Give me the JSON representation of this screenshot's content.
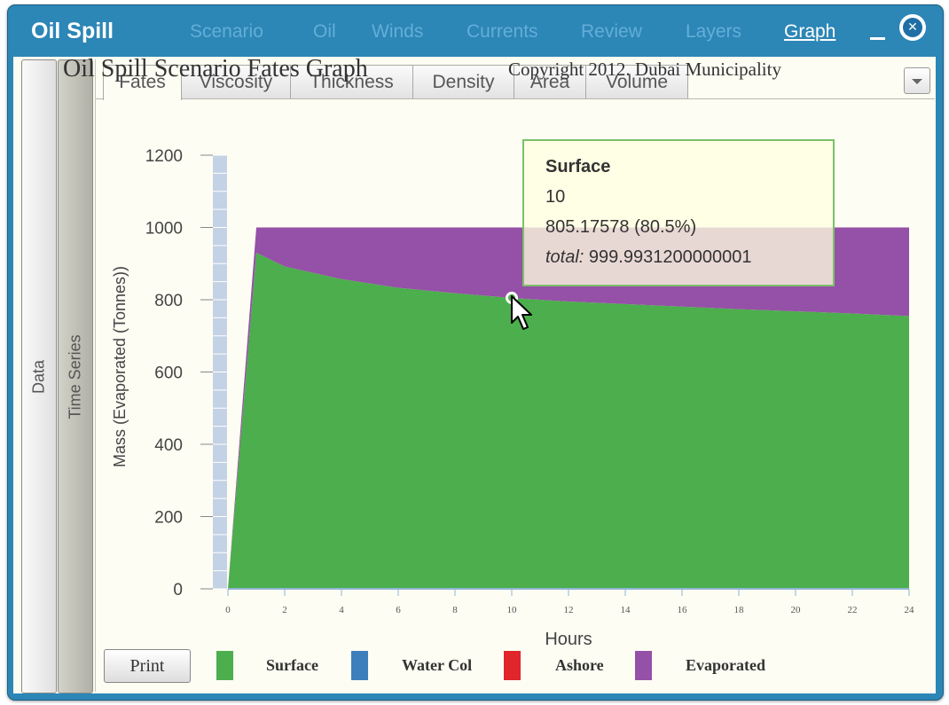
{
  "window": {
    "title": "Oil Spill",
    "menu": [
      {
        "label": "Scenario",
        "active": false
      },
      {
        "label": "Oil",
        "active": false
      },
      {
        "label": "Winds",
        "active": false
      },
      {
        "label": "Currents",
        "active": false
      },
      {
        "label": "Review",
        "active": false
      },
      {
        "label": "Layers",
        "active": false
      },
      {
        "label": "Graph",
        "active": true
      }
    ],
    "minimize_icon": "minimize-icon",
    "close_icon": "close-icon"
  },
  "side_tabs": [
    {
      "label": "Data",
      "selected": false
    },
    {
      "label": "Time Series",
      "selected": true
    }
  ],
  "tabs": [
    {
      "label": "Fates",
      "selected": true
    },
    {
      "label": "Viscosity",
      "selected": false
    },
    {
      "label": "Thickness",
      "selected": false
    },
    {
      "label": "Density",
      "selected": false
    },
    {
      "label": "Area",
      "selected": false
    },
    {
      "label": "Volume",
      "selected": false
    }
  ],
  "tooltip": {
    "series": "Surface",
    "x": "10",
    "value": "805.17578 (80.5%)",
    "total_label": "total:",
    "total_value": " 999.9931200000001"
  },
  "print_label": "Print",
  "chart_data": {
    "type": "area",
    "stacked": true,
    "title": "Oil Spill Scenario Fates Graph",
    "subtitle": "Copyright 2012. Dubai Municipality",
    "xlabel": "Hours",
    "ylabel": "Mass (Evaporated (Tonnes))",
    "xlim": [
      0,
      24
    ],
    "ylim": [
      0,
      1200
    ],
    "x_ticks": [
      0,
      2,
      4,
      6,
      8,
      10,
      12,
      14,
      16,
      18,
      20,
      22,
      24
    ],
    "y_ticks": [
      0,
      200,
      400,
      600,
      800,
      1000,
      1200
    ],
    "legend_position": "bottom",
    "x": [
      0,
      1,
      2,
      4,
      6,
      8,
      10,
      12,
      14,
      16,
      18,
      20,
      22,
      24
    ],
    "series": [
      {
        "name": "Surface",
        "color": "#4cae4c",
        "values": [
          0,
          930,
          892,
          857,
          833,
          818,
          805,
          795,
          788,
          781,
          774,
          768,
          762,
          755
        ]
      },
      {
        "name": "Water Col",
        "color": "#3d7fbd",
        "values": [
          0,
          0,
          0,
          0,
          0,
          0,
          0,
          0,
          0,
          0,
          0,
          0,
          0,
          0
        ]
      },
      {
        "name": "Ashore",
        "color": "#e0252b",
        "values": [
          0,
          0,
          0,
          0,
          0,
          0,
          0,
          0,
          0,
          0,
          0,
          0,
          0,
          0
        ]
      },
      {
        "name": "Evaporated",
        "color": "#9550a7",
        "values": [
          0,
          70,
          108,
          143,
          167,
          182,
          195,
          205,
          212,
          219,
          226,
          232,
          238,
          245
        ]
      }
    ],
    "highlight": {
      "series": "Surface",
      "x": 10,
      "y": 805.17578
    }
  }
}
